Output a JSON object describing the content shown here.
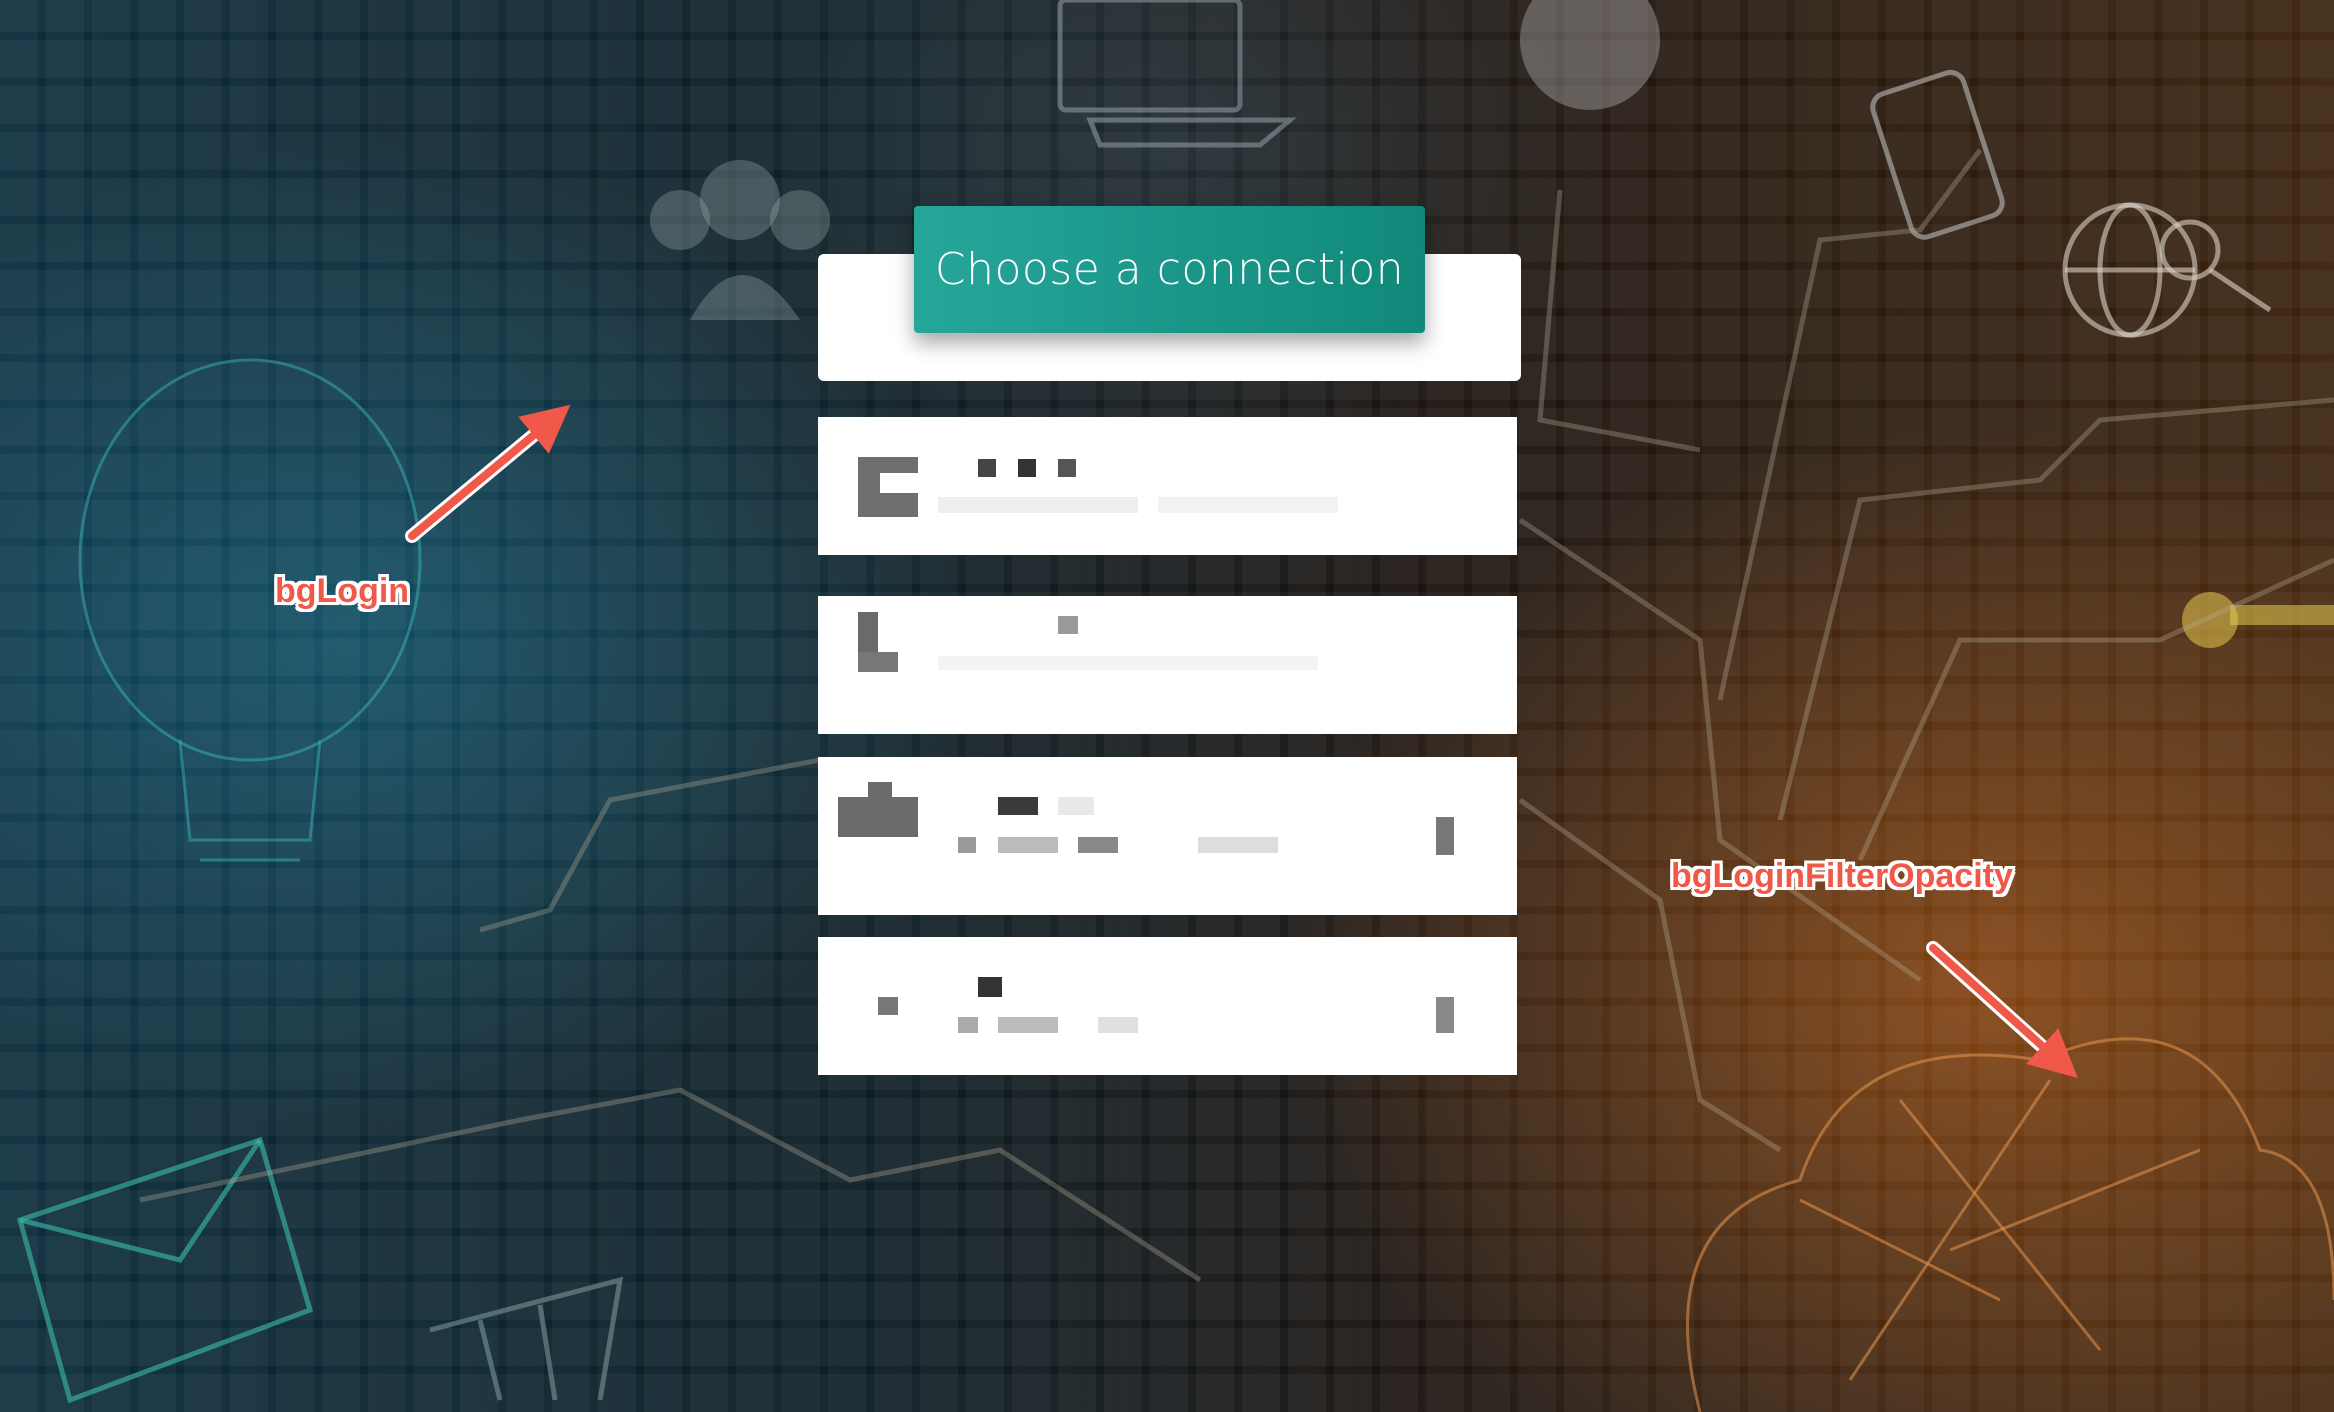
{
  "header": {
    "title": "Choose a connection"
  },
  "connections": [
    {
      "id": "conn-1"
    },
    {
      "id": "conn-2"
    },
    {
      "id": "conn-3"
    },
    {
      "id": "conn-4"
    }
  ],
  "annotations": {
    "bg_login": "bgLogin",
    "bg_login_filter_opacity": "bgLoginFilterOpacity"
  },
  "colors": {
    "accent": "#26a69a",
    "annotation": "#f0584a"
  }
}
